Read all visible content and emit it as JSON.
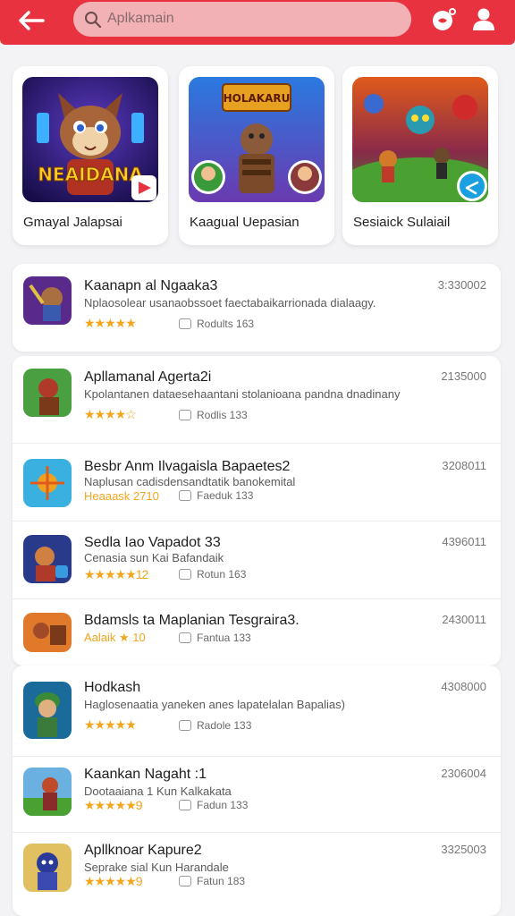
{
  "header": {
    "search_placeholder": "Aplkamain",
    "colors": {
      "header": "#e8323f",
      "search_bg": "#f2b2b5"
    },
    "icons": [
      "back-arrow-icon",
      "search-icon",
      "notification-icon",
      "profile-icon"
    ]
  },
  "featured": [
    {
      "title": "Gmayal Jalapsai",
      "art_text": "NEAIDANA",
      "badge": "play-badge-icon"
    },
    {
      "title": "Kaagual Uepasian",
      "art_text": "HOLAKARU",
      "badge": "avatar-badges"
    },
    {
      "title": "Sesiaick Sulaiail",
      "art_text": "",
      "badge": "share-badge-icon"
    }
  ],
  "apps": [
    {
      "name": "Kaanapn al Ngaaka3",
      "desc": "Nplaosolear usanaobssoet faectabaikarrionada dialaagy.",
      "stars": "★★★★★",
      "reviews": "Rodults 163",
      "number": "3:330002"
    },
    {
      "name": "Apllamanal Agerta2i",
      "desc": "Kpolantanen dataesehaantani stolanioana pandna dnadinany",
      "stars": "★★★★☆",
      "reviews": "Rodlis 133",
      "number": "2135000"
    },
    {
      "name": "Besbr Anm Ilvagaisla Bapaetes2",
      "desc": "Naplusan cadisdensandtatik banokemital",
      "stars": "Heaaask 2710",
      "reviews": "Faeduk 133",
      "number": "3208011"
    },
    {
      "name": "Sedla Iao Vapadot 33",
      "desc": "Cenasia sun Kai Bafandaik",
      "stars": "★★★★★12",
      "reviews": "Rotun 163",
      "number": "4396011"
    },
    {
      "name": "Bdamsls ta Maplanian Tesgraira3.",
      "desc": "",
      "stars": "Aalaik ★ 10",
      "reviews": "Fantua 133",
      "number": "2430011"
    },
    {
      "name": "Hodkash",
      "desc": "Haglosenaatia yaneken anes lapatelalan Bapalias)",
      "stars": "★★★★★",
      "reviews": "Radole 133",
      "number": "4308000"
    },
    {
      "name": "Kaankan Nagaht :1",
      "desc": "Dootaaiana 1 Kun Kalkakata",
      "stars": "★★★★★9",
      "reviews": "Fadun 133",
      "number": "2306004"
    },
    {
      "name": "Apllknoar Kapure2",
      "desc": "Seprake sial Kun Harandale",
      "stars": "★★★★★9",
      "reviews": "Fatun 183",
      "number": "3325003"
    }
  ]
}
